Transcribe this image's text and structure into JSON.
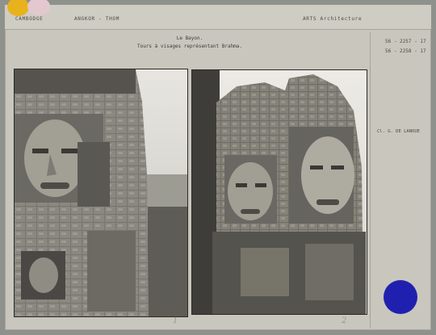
{
  "header": {
    "country": "CAMBODGE",
    "region": "ANGKOR - THOM",
    "subject": "ARTS  Architecture"
  },
  "caption": {
    "title": "Le Bayon.",
    "description": "Tours à visages représentant Brahma."
  },
  "references": {
    "ref1": "56 - 2257 - 17",
    "ref2": "56 - 2258 - 17",
    "credit": "Cl. G. DE LANOUE"
  },
  "photos": [
    {
      "number": "1"
    },
    {
      "number": "2"
    }
  ],
  "colors": {
    "sticker_yellow": "#e8b21c",
    "sticker_pink": "#e3c8cf",
    "blue_dot": "#2020b0"
  }
}
